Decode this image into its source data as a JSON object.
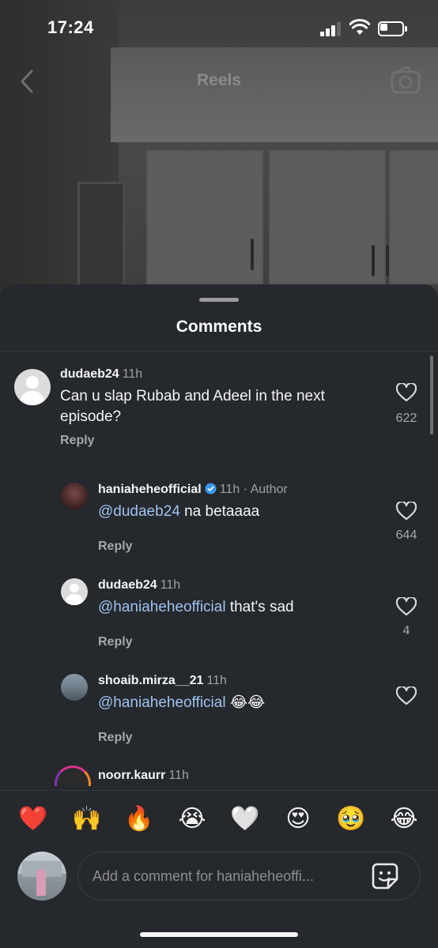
{
  "status_bar": {
    "time": "17:24"
  },
  "top_nav": {
    "title": "Reels"
  },
  "sheet": {
    "title": "Comments"
  },
  "comments": [
    {
      "username": "dudaeb24",
      "time": "11h",
      "text": "Can u slap Rubab and Adeel in the next episode?",
      "reply_label": "Reply",
      "likes": "622"
    },
    {
      "username": "haniaheheofficial",
      "verified": true,
      "time": "11h",
      "author_tag": "· Author",
      "mention": "@dudaeb24",
      "text": " na betaaaa",
      "reply_label": "Reply",
      "likes": "644"
    },
    {
      "username": "dudaeb24",
      "time": "11h",
      "mention": "@haniaheheofficial",
      "text": " that's sad",
      "reply_label": "Reply",
      "likes": "4"
    },
    {
      "username": "shoaib.mirza__21",
      "time": "11h",
      "mention": "@haniaheheofficial",
      "text": " 😂😂",
      "reply_label": "Reply",
      "likes": ""
    },
    {
      "username": "noorr.kaurr",
      "time": "11h"
    }
  ],
  "emoji_bar": [
    "❤️",
    "🙌",
    "🔥",
    "😭",
    "🤍",
    "😍",
    "🥹",
    "😂"
  ],
  "composer": {
    "placeholder": "Add a comment for haniaheheoffi..."
  }
}
